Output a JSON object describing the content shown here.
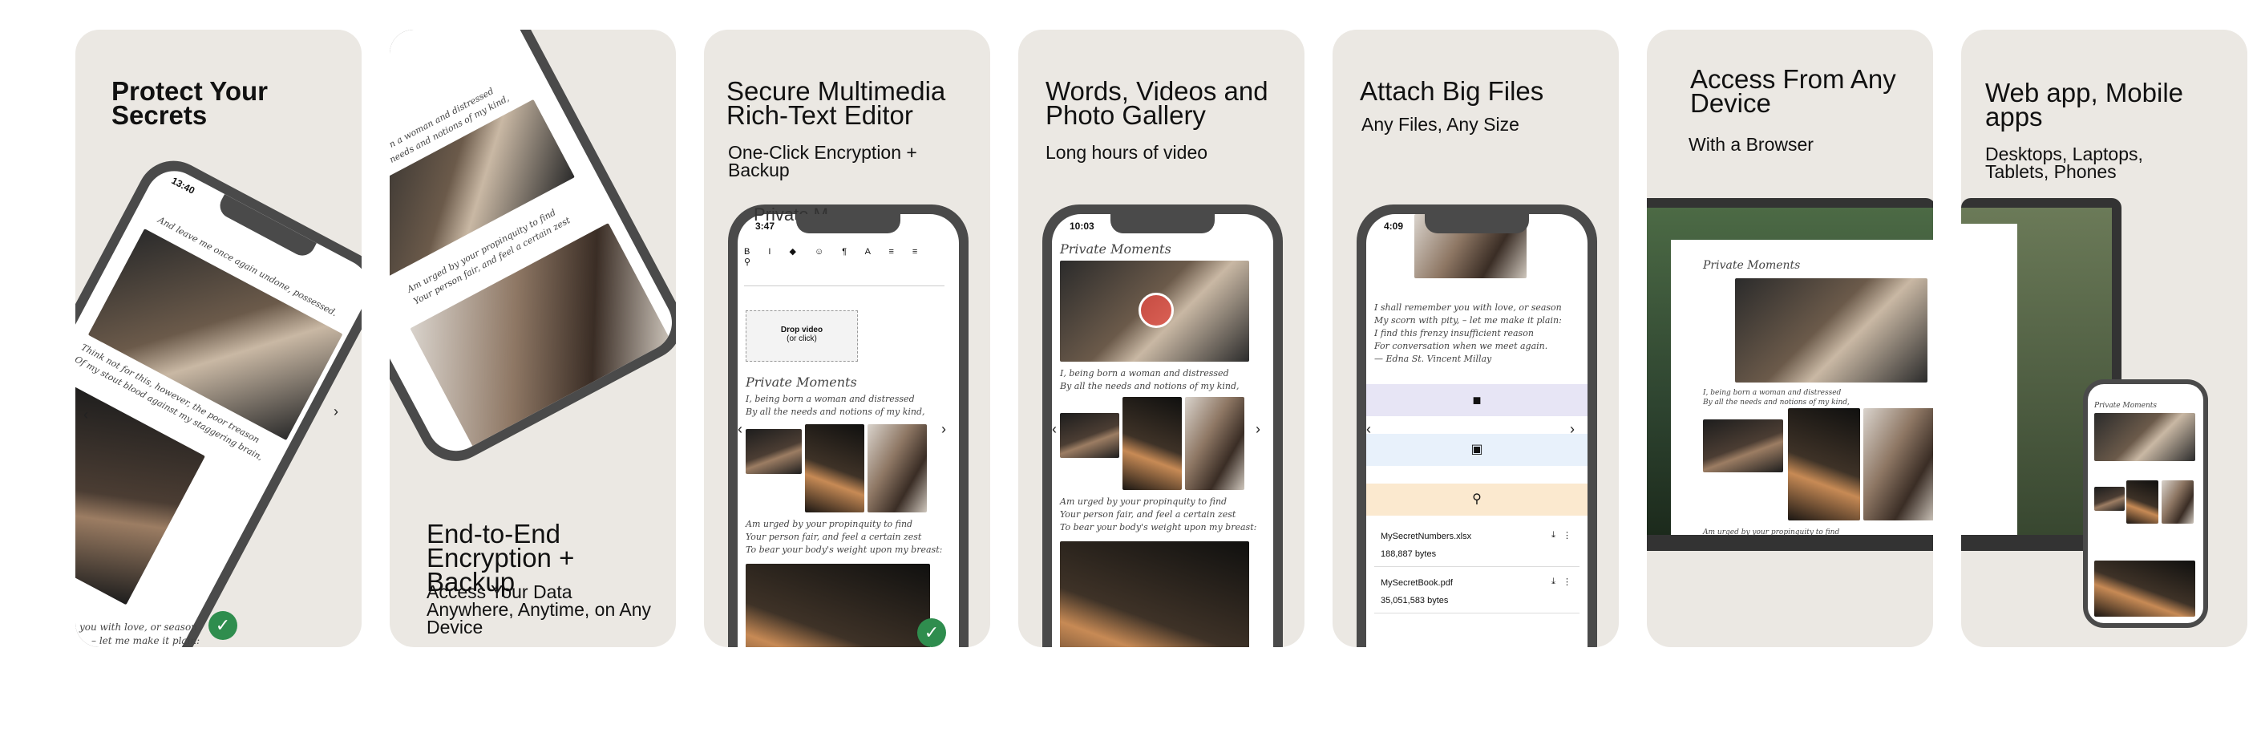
{
  "cards": [
    {
      "title": "Protect Your Secrets",
      "phone_time": "13:40",
      "poem": [
        "Think not for this, however, the poor treason",
        "Of my stout blood against my staggering brain,"
      ],
      "poem_bottom": [
        "you with love, or season",
        "– let me make it plain:"
      ],
      "top_line": "And leave me once again undone, possessed."
    },
    {
      "title": "End-to-End Encryption + Backup",
      "subtitle": "Access Your Data Anywhere, Anytime, on Any Device",
      "top_lines": [
        "I, being born a woman and distressed",
        "By all the needs and notions of my kind,"
      ],
      "mid_lines": [
        "Am urged by your propinquity to find",
        "Your person fair, and feel a certain zest"
      ]
    },
    {
      "title": "Secure Multimedia Rich-Text Editor",
      "subtitle": "One-Click Encryption + Backup",
      "phone_time": "3:47",
      "overlay_text": "Private M",
      "drop_label": "Drop video",
      "drop_sub": "(or click)",
      "doc_title": "Private Moments",
      "lines1": [
        "I, being born a woman and distressed",
        "By all the needs and notions of my kind,"
      ],
      "lines2": [
        "Am urged by your propinquity to find",
        "Your person fair, and feel a certain zest",
        "To bear your body's weight upon my breast:"
      ]
    },
    {
      "title": "Words, Videos and Photo Gallery",
      "subtitle": "Long hours of video",
      "phone_time": "10:03",
      "doc_title": "Private Moments",
      "lines1": [
        "I, being born a woman and distressed",
        "By all the needs and notions of my kind,"
      ],
      "lines2": [
        "Am urged by your propinquity to find",
        "Your person fair, and feel a certain zest",
        "To bear your body's weight upon my breast:"
      ]
    },
    {
      "title": "Attach Big Files",
      "subtitle": "Any Files, Any Size",
      "phone_time": "4:09",
      "poem": [
        "I shall remember you with love, or season",
        "My scorn with pity, – let me make it plain:",
        "I find this frenzy insufficient reason",
        "For conversation when we meet again.",
        "— Edna St. Vincent Millay"
      ],
      "files": [
        {
          "name": "MySecretNumbers.xlsx",
          "size": "188,887 bytes"
        },
        {
          "name": "MySecretBook.pdf",
          "size": "35,051,583 bytes"
        }
      ]
    },
    {
      "title": "Access From Any Device",
      "subtitle": "With a Browser",
      "doc_title": "Private Moments",
      "lines1": [
        "I, being born a woman and distressed",
        "By all the needs and notions of my kind,"
      ],
      "lines2": [
        "Am urged by your propinquity to find"
      ]
    },
    {
      "title": "Web app, Mobile apps",
      "subtitle": "Desktops, Laptops, Tablets, Phones",
      "doc_title": "Private Moments"
    }
  ],
  "colors": {
    "card_bg": "#ebe8e3",
    "phone_frame": "#4a4a4a",
    "check": "#2f8d4e",
    "video_bar": "#e7e5f5",
    "image_bar": "#e8f1fb",
    "attach_bar": "#fbe9cf"
  },
  "icons": [
    "check-icon",
    "chevron-left-icon",
    "chevron-right-icon",
    "play-icon",
    "video-icon",
    "image-icon",
    "paperclip-icon",
    "download-icon",
    "more-icon",
    "file-icon"
  ]
}
